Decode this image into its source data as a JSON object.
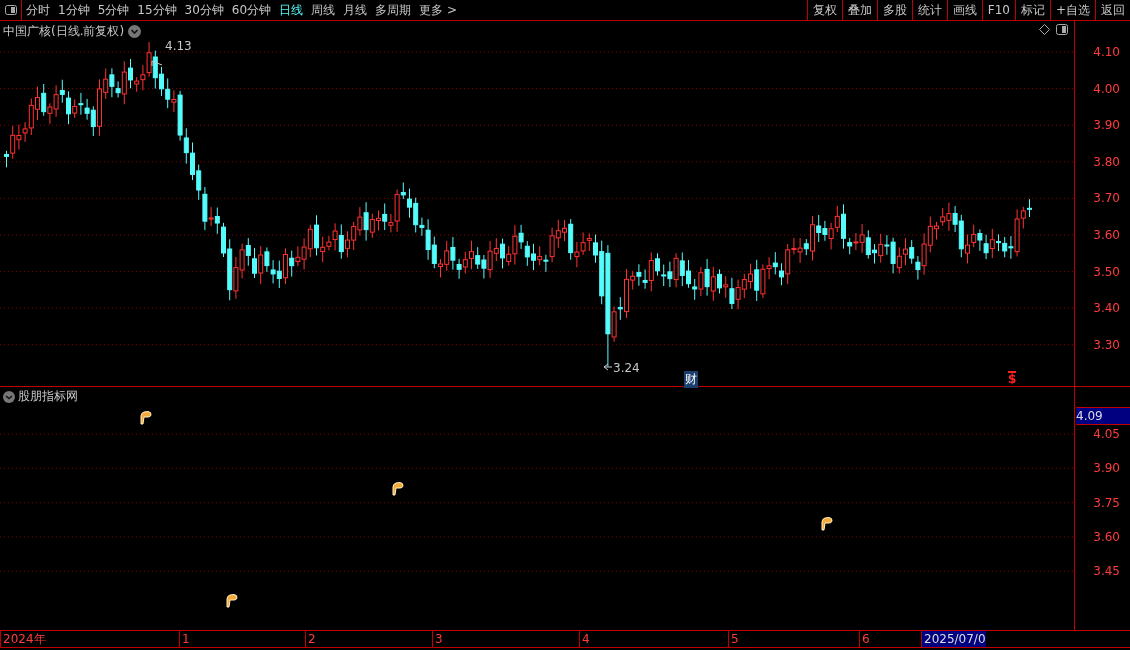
{
  "toolbar": {
    "periods": [
      {
        "label": "分时",
        "selected": false
      },
      {
        "label": "1分钟",
        "selected": false
      },
      {
        "label": "5分钟",
        "selected": false
      },
      {
        "label": "15分钟",
        "selected": false
      },
      {
        "label": "30分钟",
        "selected": false
      },
      {
        "label": "60分钟",
        "selected": false
      },
      {
        "label": "日线",
        "selected": true
      },
      {
        "label": "周线",
        "selected": false
      },
      {
        "label": "月线",
        "selected": false
      },
      {
        "label": "多周期",
        "selected": false
      },
      {
        "label": "更多 >",
        "selected": false
      }
    ],
    "actions": [
      "复权",
      "叠加",
      "多股",
      "统计",
      "画线",
      "F10",
      "标记",
      "+自选",
      "返回"
    ]
  },
  "price_chart": {
    "title": "中国广核(日线.前复权)",
    "high_label": "4.13",
    "low_label": "3.24",
    "axis_labels": [
      "4.10",
      "4.00",
      "3.90",
      "3.80",
      "3.70",
      "3.60",
      "3.50",
      "3.40",
      "3.30"
    ],
    "event_marks": [
      {
        "kind": "finance",
        "text": "财"
      },
      {
        "kind": "dividend",
        "text": "$"
      }
    ]
  },
  "indicator": {
    "title": "股朋指标网",
    "current_value": "4.09",
    "axis_labels": [
      "4.05",
      "3.90",
      "3.75",
      "3.60",
      "3.45"
    ]
  },
  "date_axis": {
    "labels": [
      {
        "text": "2024年",
        "selected": false
      },
      {
        "text": "1",
        "selected": false
      },
      {
        "text": "2",
        "selected": false
      },
      {
        "text": "3",
        "selected": false
      },
      {
        "text": "4",
        "selected": false
      },
      {
        "text": "5",
        "selected": false
      },
      {
        "text": "6",
        "selected": false
      },
      {
        "text": "2025/07/0",
        "selected": true
      }
    ]
  }
}
